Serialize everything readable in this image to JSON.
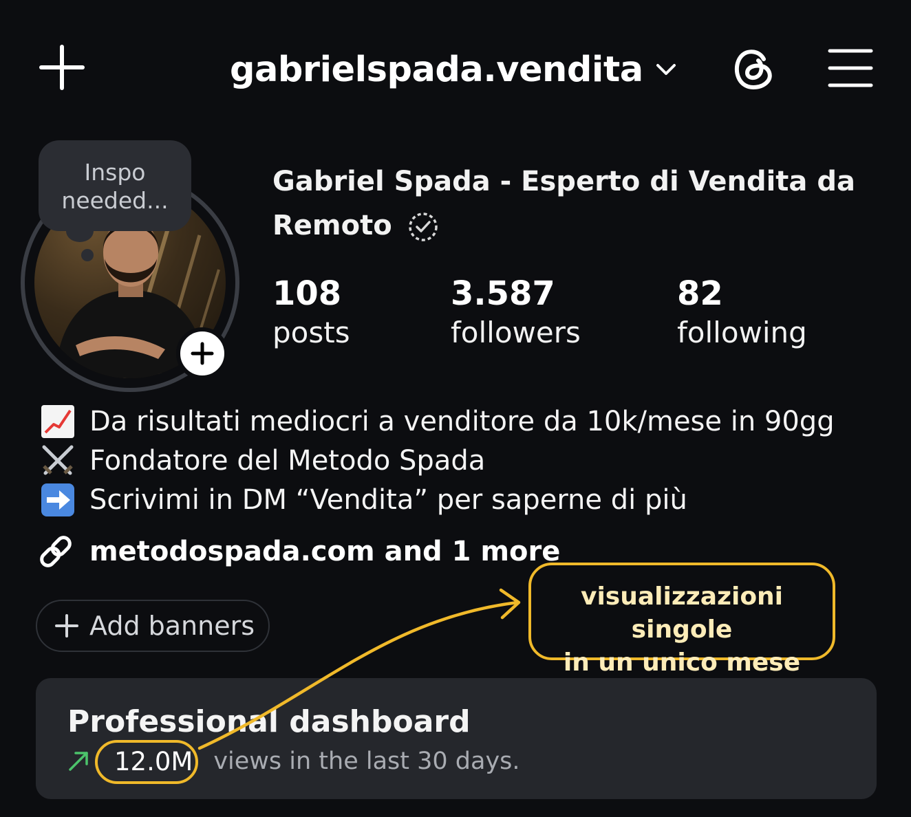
{
  "header": {
    "username": "gabrielspada.vendita",
    "icons": [
      "plus-icon",
      "chevron-down-icon",
      "threads-icon",
      "menu-icon"
    ]
  },
  "profile": {
    "note_line1": "Inspo",
    "note_line2": "needed...",
    "display_name": "Gabriel Spada - Esperto di Vendita da Remoto",
    "verified": true,
    "stats": [
      {
        "value": "108",
        "label": "posts"
      },
      {
        "value": "3.587",
        "label": "followers"
      },
      {
        "value": "82",
        "label": "following"
      }
    ]
  },
  "bio": {
    "lines": [
      {
        "icon": "chart-increasing-icon",
        "text": "Da risultati mediocri a venditore da 10k/mese in 90gg"
      },
      {
        "icon": "crossed-swords-icon",
        "text": "Fondatore del Metodo Spada"
      },
      {
        "icon": "right-arrow-icon",
        "text": "Scrivimi in DM “Vendita” per saperne di più"
      }
    ],
    "link": "metodospada.com and 1 more"
  },
  "add_banners": "Add banners",
  "dashboard": {
    "title": "Professional dashboard",
    "views": "12.0M",
    "views_suffix": "views in the last 30 days."
  },
  "annotation": {
    "line1": "visualizzazioni singole",
    "line2": "in un unico mese",
    "color": "#f0b92a"
  },
  "colors": {
    "background": "#0c0d10",
    "card": "#25272c",
    "trend_green": "#4cc36b",
    "highlight": "#f0b92a"
  }
}
